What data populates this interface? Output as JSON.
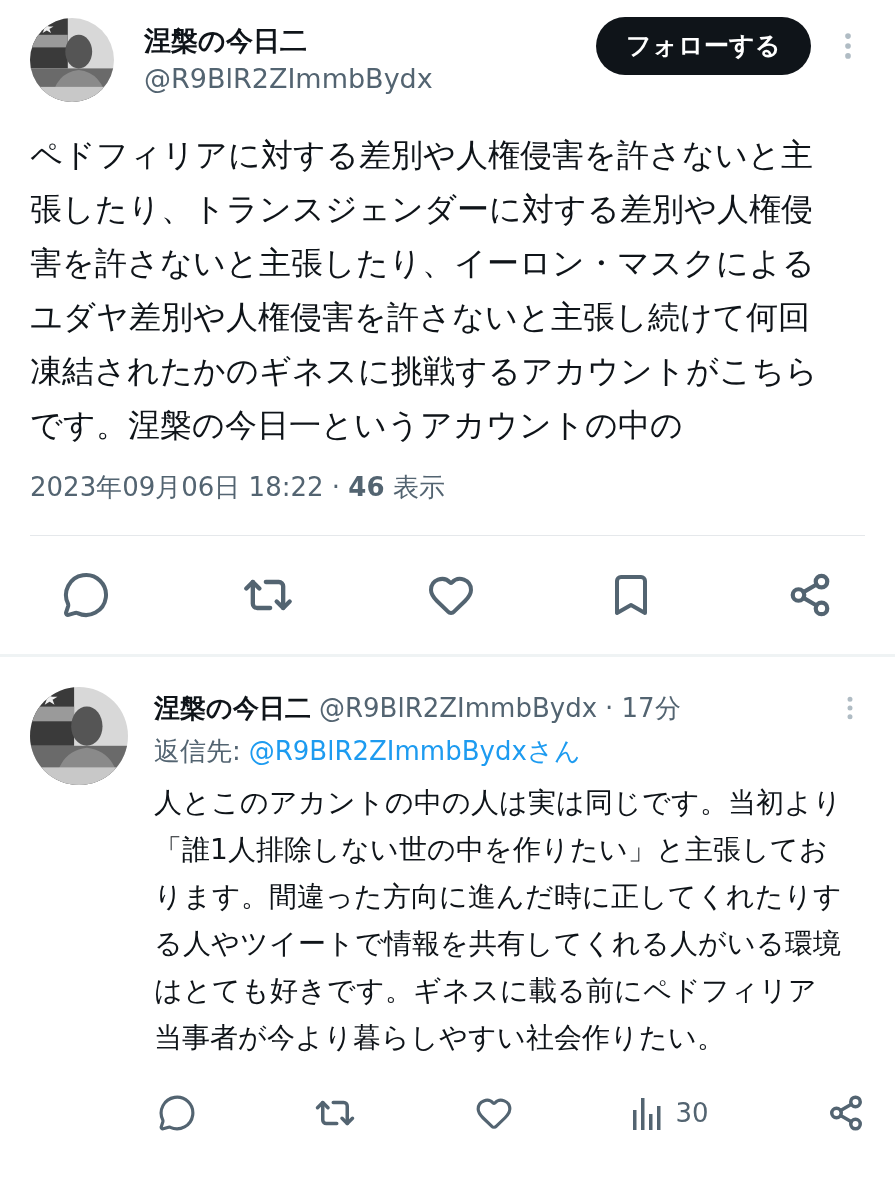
{
  "tweet": {
    "name": "涅槃の今日二",
    "handle": "@R9BlR2ZImmbBydx",
    "follow_button": "フォローする",
    "text": "ペドフィリアに対する差別や人権侵害を許さないと主張したり、トランスジェンダーに対する差別や人権侵害を許さないと主張したり、イーロン・マスクによるユダヤ差別や人権侵害を許さないと主張し続けて何回凍結されたかのギネスに挑戦するアカウントがこちらです。涅槃の今日一というアカウントの中の",
    "meta": "2023年09月06日 18:22 · **46** 表示"
  },
  "reply": {
    "name": "涅槃の今日二",
    "handle": "@R9BlR2ZImmbBydx",
    "time": "· 17分",
    "reply_to_label": "返信先:",
    "reply_to": "@R9BlR2ZImmbBydxさん",
    "text": "人とこのアカントの中の人は実は同じです。当初より「誰1人排除しない世の中を作りたい」と主張しております。間違った方向に進んだ時に正してくれたりする人やツイートで情報を共有してくれる人がいる環境はとても好きです。ギネスに載る前にペドフィリア当事者が今より暮らしやすい社会作りたい。",
    "views": "30"
  }
}
